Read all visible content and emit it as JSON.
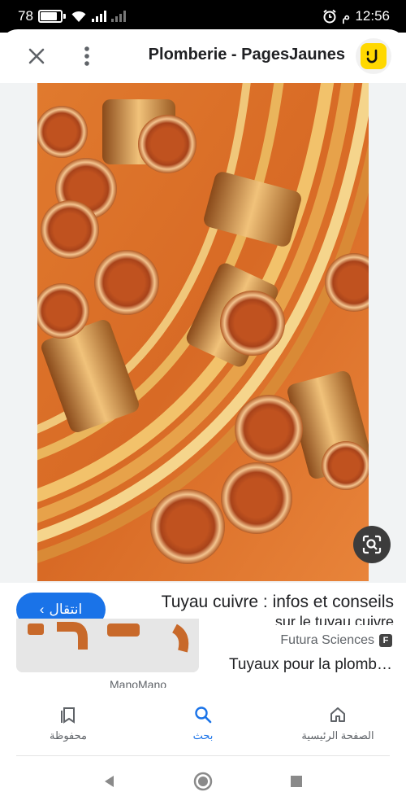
{
  "status_bar": {
    "battery": "78",
    "battery_level": 0.78,
    "clock": "12:56",
    "clock_period": "م"
  },
  "header": {
    "title": "Plomberie - PagesJaunes"
  },
  "image_viewer": {
    "main_image_alt": "copper pipes and fittings"
  },
  "result": {
    "title": "Tuyau cuivre : infos et conseils",
    "subtitle": "sur le tuyau cuivre",
    "visit_label": "انتقال"
  },
  "related": {
    "source_name": "Futura Sciences",
    "source_icon_letter": "F",
    "title": "Tuyaux pour la plomb…",
    "thumb_source": "ManoMano"
  },
  "bottom_nav": {
    "saved_label": "محفوظة",
    "search_label": "بحث",
    "home_label": "الصفحة الرئيسية"
  },
  "colors": {
    "accent": "#1a73e8",
    "logo_yellow": "#ffd800",
    "copper": "#c8692a"
  }
}
